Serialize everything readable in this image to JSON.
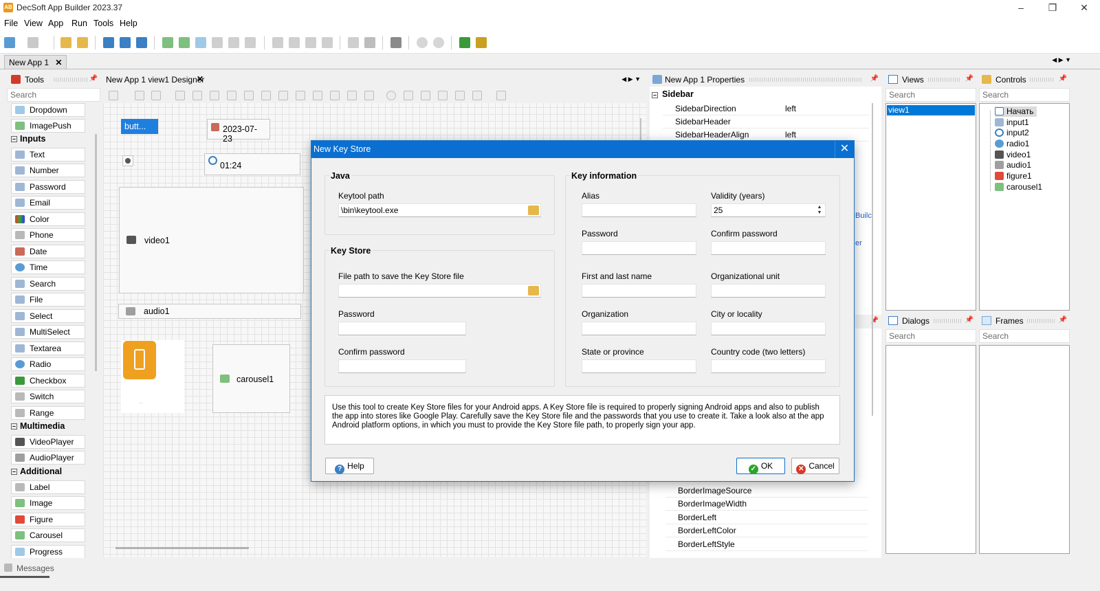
{
  "window": {
    "title": "DecSoft App Builder 2023.37",
    "app_icon_text": "AB"
  },
  "menu": [
    "File",
    "View",
    "App",
    "Run",
    "Tools",
    "Help"
  ],
  "doc_tab": "New App 1",
  "tools": {
    "title": "Tools",
    "search_placeholder": "Search",
    "items_top": [
      "Dropdown",
      "ImagePush"
    ],
    "cat_inputs": "Inputs",
    "inputs": [
      "Text",
      "Number",
      "Password",
      "Email",
      "Color",
      "Phone",
      "Date",
      "Time",
      "Search",
      "File",
      "Select",
      "MultiSelect",
      "Textarea",
      "Radio",
      "Checkbox",
      "Switch",
      "Range"
    ],
    "cat_multimedia": "Multimedia",
    "multimedia": [
      "VideoPlayer",
      "AudioPlayer"
    ],
    "cat_additional": "Additional",
    "additional": [
      "Label",
      "Image",
      "Figure",
      "Carousel",
      "Progress"
    ]
  },
  "designer": {
    "tab": "New App 1 view1 Designer",
    "button_label": "butt...",
    "date_value": "2023-07-23",
    "time_value": "01:24",
    "video_label": "video1",
    "audio_label": "audio1",
    "carousel_label": "carousel1",
    "figure_caption": "..."
  },
  "properties": {
    "title": "New App 1 Properties",
    "section": "Sidebar",
    "rows_top": [
      {
        "name": "SidebarDirection",
        "value": "left"
      },
      {
        "name": "SidebarHeader",
        "value": ""
      },
      {
        "name": "SidebarHeaderAlign",
        "value": "left"
      }
    ],
    "rows_bottom": [
      "BorderImageSource",
      "BorderImageWidth",
      "BorderLeft",
      "BorderLeftColor",
      "BorderLeftStyle"
    ],
    "partial_text_1": "Builc",
    "partial_text_2": "er"
  },
  "views": {
    "title": "Views",
    "search_placeholder": "Search",
    "items": [
      "view1"
    ]
  },
  "controls": {
    "title": "Controls",
    "search_placeholder": "Search",
    "items": [
      "Начать",
      "input1",
      "input2",
      "radio1",
      "video1",
      "audio1",
      "figure1",
      "carousel1"
    ]
  },
  "dialogs": {
    "title": "Dialogs",
    "search_placeholder": "Search"
  },
  "frames": {
    "title": "Frames",
    "search_placeholder": "Search"
  },
  "messages": "Messages",
  "dialog": {
    "title": "New Key Store",
    "java_group": "Java",
    "keytool_label": "Keytool path",
    "keytool_value": "\\bin\\keytool.exe",
    "keystore_group": "Key Store",
    "filepath_label": "File path to save the Key Store file",
    "filepath_value": "",
    "ks_password_label": "Password",
    "ks_confirm_label": "Confirm password",
    "keyinfo_group": "Key information",
    "alias_label": "Alias",
    "validity_label": "Validity (years)",
    "validity_value": "25",
    "password_label": "Password",
    "confirm_label": "Confirm password",
    "name_label": "First and last name",
    "org_unit_label": "Organizational unit",
    "org_label": "Organization",
    "city_label": "City or locality",
    "state_label": "State or province",
    "country_label": "Country code (two letters)",
    "info_text": "Use this tool to create Key Store files for your Android apps. A Key Store file is required to properly signing Android apps and also to publish the app into stores like Google Play. Carefully save the Key Store file and the passwords that you use to create it. Take a look also at the app Android platform options, in which you must to provide the Key Store file path, to properly sign your app.",
    "help_button": "Help",
    "ok_button": "OK",
    "cancel_button": "Cancel"
  },
  "colors": {
    "accent": "#0a6fd1",
    "ok_green": "#2aa52a",
    "cancel_red": "#d33a2c",
    "selection": "#0078d7"
  }
}
